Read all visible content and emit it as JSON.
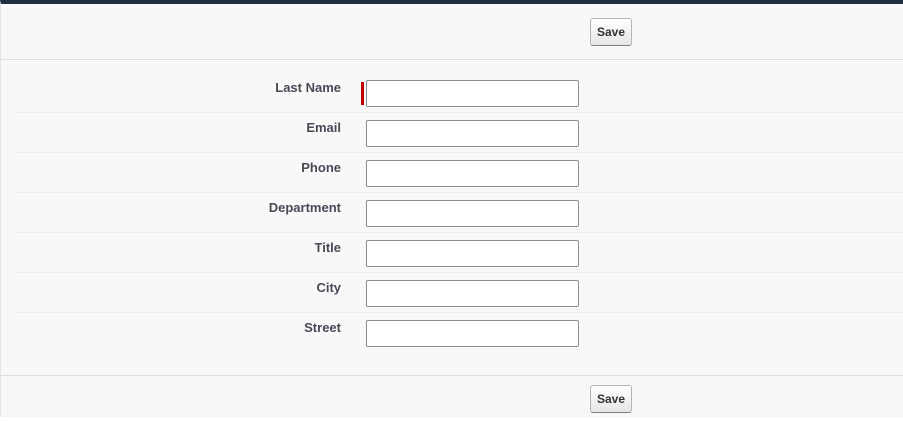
{
  "buttons": {
    "top_save_label": "Save",
    "bottom_save_label": "Save"
  },
  "fields": [
    {
      "label": "Last Name",
      "value": "",
      "required": true
    },
    {
      "label": "Email",
      "value": "",
      "required": false
    },
    {
      "label": "Phone",
      "value": "",
      "required": false
    },
    {
      "label": "Department",
      "value": "",
      "required": false
    },
    {
      "label": "Title",
      "value": "",
      "required": false
    },
    {
      "label": "City",
      "value": "",
      "required": false
    },
    {
      "label": "Street",
      "value": "",
      "required": false
    }
  ],
  "colors": {
    "required_marker": "#c00000",
    "top_border": "#1f2f44",
    "background": "#f8f8f8"
  }
}
